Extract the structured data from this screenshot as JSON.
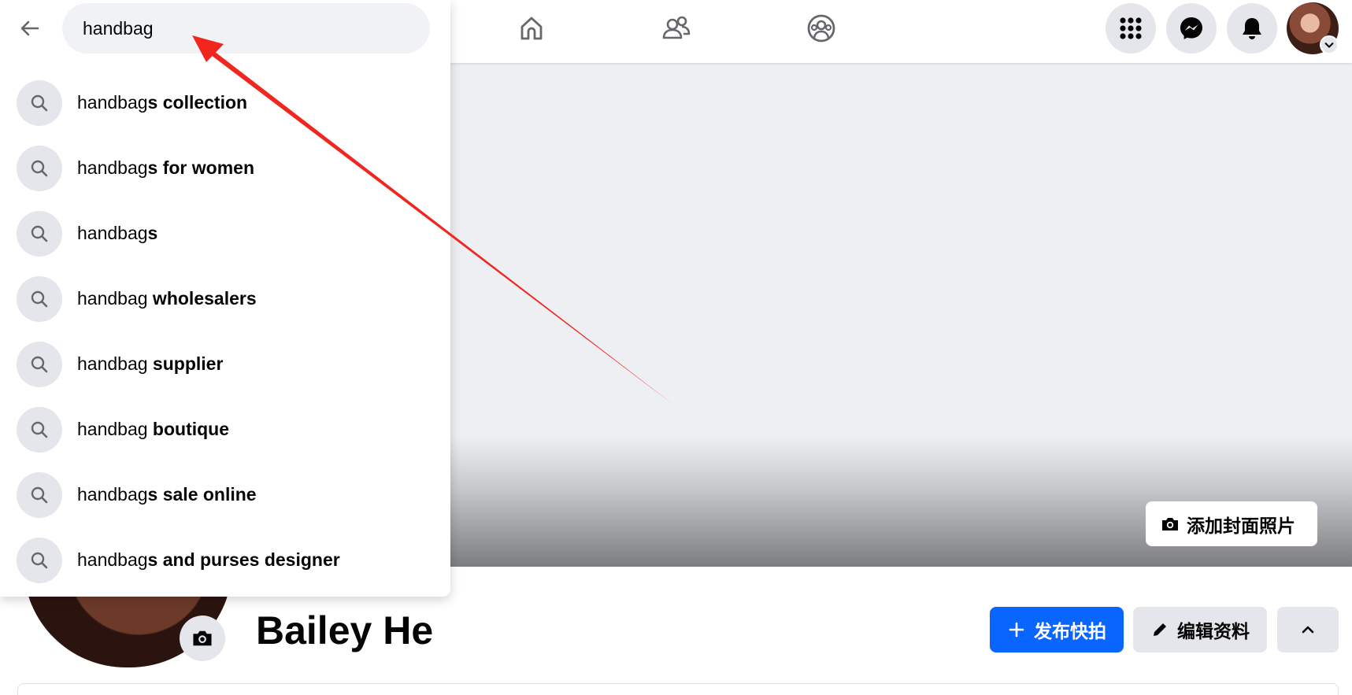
{
  "topbar": {
    "tabs": [
      {
        "name": "home",
        "icon": "home-icon"
      },
      {
        "name": "friends",
        "icon": "friends-icon"
      },
      {
        "name": "groups",
        "icon": "groups-icon"
      }
    ],
    "right_buttons": [
      {
        "name": "menu",
        "icon": "grid-menu-icon"
      },
      {
        "name": "messenger",
        "icon": "messenger-icon"
      },
      {
        "name": "notifications",
        "icon": "bell-icon"
      }
    ],
    "account_icon": "avatar"
  },
  "search": {
    "query": "handbag",
    "suggestions": [
      {
        "typed": "handbag",
        "completion": "s collection"
      },
      {
        "typed": "handbag",
        "completion": "s for women"
      },
      {
        "typed": "handbag",
        "completion": "s"
      },
      {
        "typed": "handbag",
        "completion": " wholesalers"
      },
      {
        "typed": "handbag",
        "completion": " supplier"
      },
      {
        "typed": "handbag",
        "completion": " boutique"
      },
      {
        "typed": "handbag",
        "completion": "s sale online"
      },
      {
        "typed": "handbag",
        "completion": "s and purses designer"
      }
    ]
  },
  "cover": {
    "add_cover_label": "添加封面照片"
  },
  "profile": {
    "name": "Bailey He",
    "create_story_label": "发布快拍",
    "edit_profile_label": "编辑资料"
  },
  "colors": {
    "primary_blue": "#0866ff",
    "button_gray": "#e4e6eb",
    "input_gray": "#f0f2f5",
    "annotation_red": "#f0261f"
  }
}
